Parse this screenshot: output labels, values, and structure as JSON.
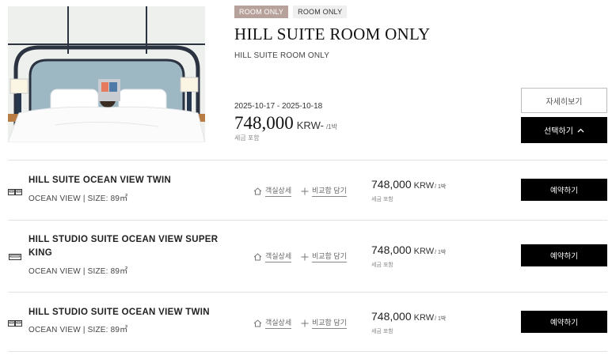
{
  "product": {
    "badges": [
      "ROOM ONLY",
      "ROOM ONLY"
    ],
    "title": "HILL SUITE ROOM ONLY",
    "subtitle": "HILL SUITE ROOM ONLY",
    "dates": "2025-10-17 - 2025-10-18",
    "price": "748,000",
    "currency": "KRW- ",
    "per_night": "/1박",
    "tax_note": "세금 포함",
    "detail_button": "자세히보기",
    "select_button": "선택하기"
  },
  "rooms": [
    {
      "name": "HILL SUITE OCEAN VIEW TWIN",
      "meta": "OCEAN VIEW | SIZE: 89㎡",
      "detail_link": "객실상세",
      "compare_link": "비교함 담기",
      "price": "748,000",
      "currency": "KRW",
      "per_night": "/ 1박",
      "tax_note": "세금 포함",
      "book_button": "예약하기",
      "bed_icon": "twin-bed-icon"
    },
    {
      "name": "HILL STUDIO SUITE OCEAN VIEW SUPER KING",
      "meta": "OCEAN VIEW | SIZE: 89㎡",
      "detail_link": "객실상세",
      "compare_link": "비교함 담기",
      "price": "748,000",
      "currency": "KRW",
      "per_night": "/ 1박",
      "tax_note": "세금 포함",
      "book_button": "예약하기",
      "bed_icon": "king-bed-icon"
    },
    {
      "name": "HILL STUDIO SUITE OCEAN VIEW TWIN",
      "meta": "OCEAN VIEW | SIZE: 89㎡",
      "detail_link": "객실상세",
      "compare_link": "비교함 담기",
      "price": "748,000",
      "currency": "KRW",
      "per_night": "/ 1박",
      "tax_note": "세금 포함",
      "book_button": "예약하기",
      "bed_icon": "twin-bed-icon"
    }
  ],
  "colors": {
    "badge_primary": "#b7a19b",
    "button_dark": "#000000",
    "divider": "#e2e2e2"
  }
}
